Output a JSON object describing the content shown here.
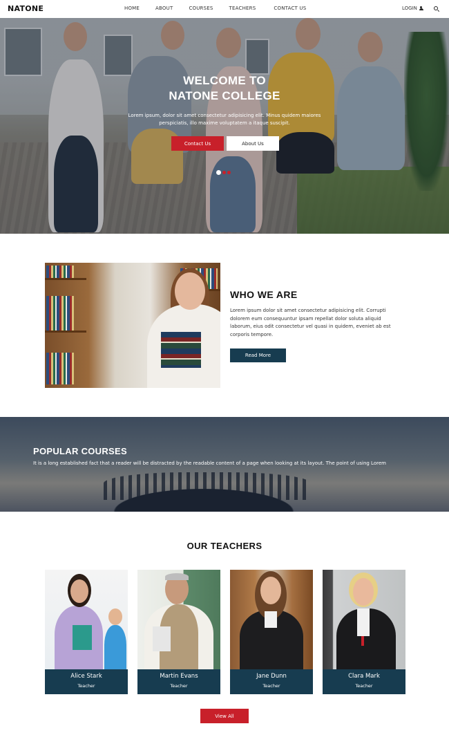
{
  "nav": {
    "logo": "NATONE",
    "items": [
      "HOME",
      "ABOUT",
      "COURSES",
      "TEACHERS",
      "CONTACT US"
    ],
    "login_label": "LOGIN"
  },
  "hero": {
    "title_line1": "WELCOME TO",
    "title_line2": "NATONE COLLEGE",
    "text": "Lorem ipsum, dolor sit amet consectetur adipisicing elit. Minus quidem maiores perspiciatis, illo maxime voluptatem a itaque suscipit.",
    "contact_button": "Contact Us",
    "about_button": "About Us"
  },
  "about": {
    "title": "WHO WE ARE",
    "text": "Lorem ipsum dolor sit amet consectetur adipisicing elit. Corrupti dolorem eum consequuntur ipsam repellat dolor soluta aliquid laborum, eius odit consectetur vel quasi in quidem, eveniet ab est corporis tempore.",
    "read_more": "Read More"
  },
  "courses": {
    "title": "POPULAR COURSES",
    "text": "It is a long established fact that a reader will be distracted by the readable content of a page when looking at its layout. The point of using Lorem"
  },
  "teachers": {
    "title": "OUR TEACHERS",
    "cards": [
      {
        "name": "Alice Stark",
        "role": "Teacher"
      },
      {
        "name": "Martin Evans",
        "role": "Teacher"
      },
      {
        "name": "Jane Dunn",
        "role": "Teacher"
      },
      {
        "name": "Clara Mark",
        "role": "Teacher"
      }
    ],
    "view_all": "View All"
  },
  "colors": {
    "accent_red": "#c8202a",
    "dark_blue": "#173c50"
  }
}
